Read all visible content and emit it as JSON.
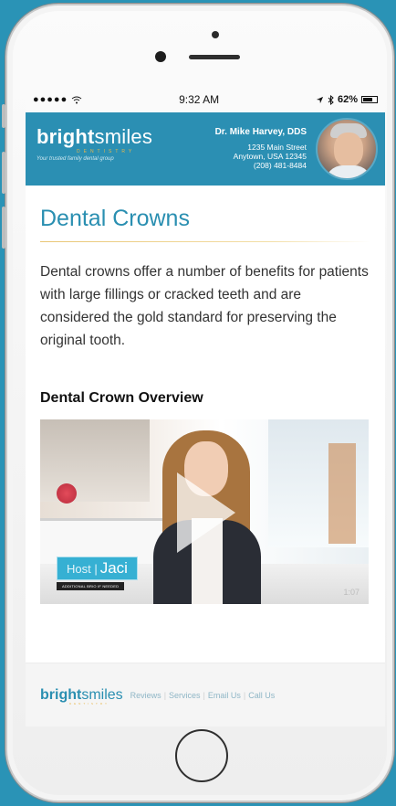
{
  "status_bar": {
    "signal": "●●●●●",
    "wifi_icon": "wifi-icon",
    "time": "9:32 AM",
    "battery_percent": "62%"
  },
  "header": {
    "logo_bold": "bright",
    "logo_light": "smiles",
    "logo_sub": "DENTISTRY",
    "tagline": "Your trusted family dental group",
    "doctor_name": "Dr. Mike Harvey, DDS",
    "address_line1": "1235 Main Street",
    "address_line2": "Anytown, USA 12345",
    "phone": "(208) 481-8484"
  },
  "page": {
    "title": "Dental Crowns",
    "intro": "Dental crowns offer a number of benefits for patients with large fillings or cracked teeth and are considered the gold standard for preserving the original tooth.",
    "section_title": "Dental Crown Overview"
  },
  "video": {
    "host_word": "Host |",
    "host_name": "Jaci",
    "host_subtitle": "ADDITIONAL BRIO IF NEEDED",
    "duration": "1:07"
  },
  "footer": {
    "logo_bold": "bright",
    "logo_light": "smiles",
    "logo_sub": "DENTISTRY",
    "links": [
      "Reviews",
      "Services",
      "Email Us",
      "Call Us"
    ]
  },
  "colors": {
    "brand_blue": "#2b8fb3",
    "title_blue": "#2a8fb1",
    "accent_gold": "#e8b64a",
    "host_tag_blue": "#36b0d3"
  }
}
